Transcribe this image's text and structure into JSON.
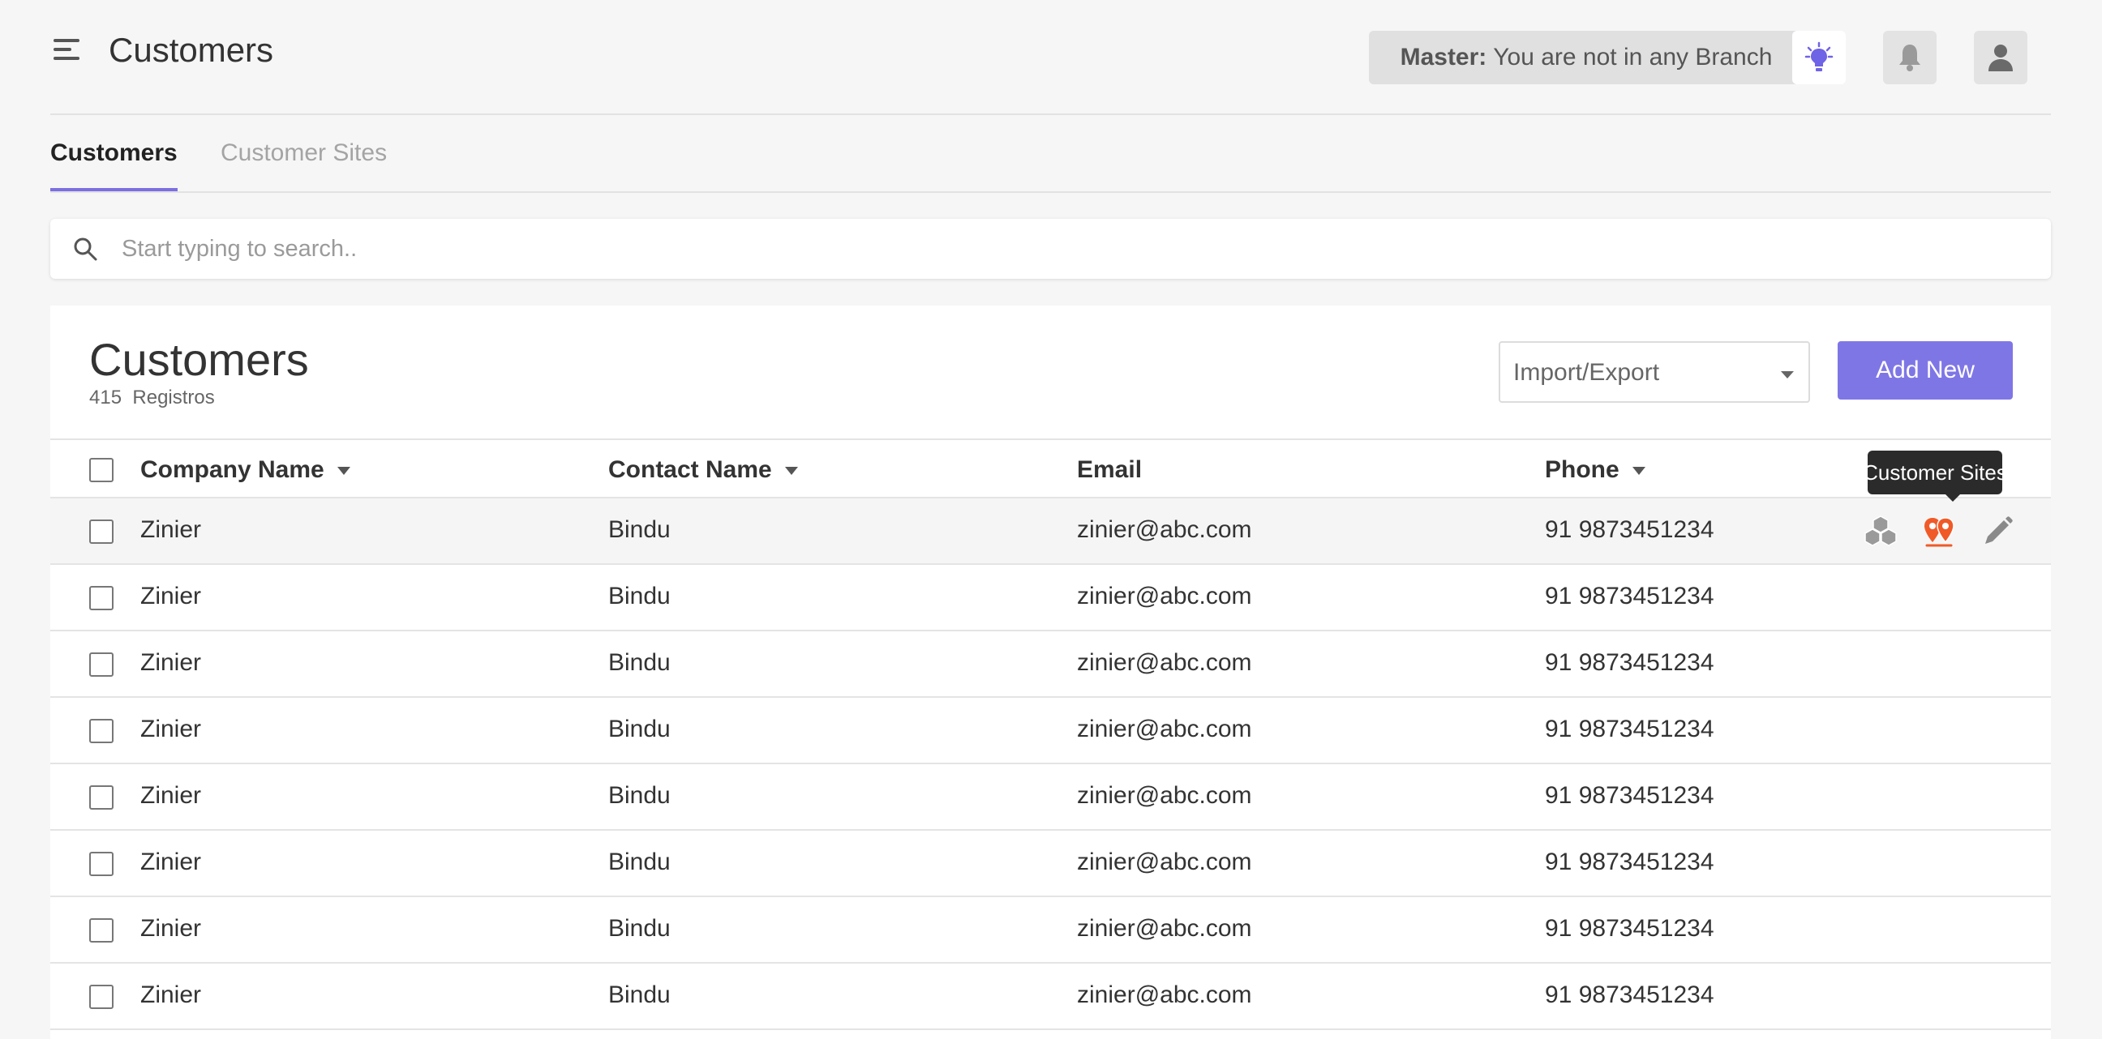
{
  "header": {
    "title": "Customers",
    "branch_label": "Master:",
    "branch_value": "You are not in any Branch",
    "menu_icon": "hamburger-menu-icon",
    "bulb_icon": "lightbulb-icon",
    "bell_icon": "bell-icon",
    "user_icon": "user-icon"
  },
  "tabs": [
    {
      "label": "Customers",
      "active": true
    },
    {
      "label": "Customer Sites",
      "active": false
    }
  ],
  "search": {
    "placeholder": "Start typing to search..",
    "value": ""
  },
  "card": {
    "title": "Customers",
    "count": "415",
    "count_label": "Registros",
    "import_export_label": "Import/Export",
    "add_new_label": "Add New"
  },
  "table": {
    "columns": [
      {
        "label": "Company Name",
        "sortable": true
      },
      {
        "label": "Contact Name",
        "sortable": true
      },
      {
        "label": "Email",
        "sortable": false
      },
      {
        "label": "Phone",
        "sortable": true
      }
    ],
    "rows": [
      {
        "company": "Zinier",
        "contact": "Bindu",
        "email": "zinier@abc.com",
        "phone": "91 9873451234"
      },
      {
        "company": "Zinier",
        "contact": "Bindu",
        "email": "zinier@abc.com",
        "phone": "91 9873451234"
      },
      {
        "company": "Zinier",
        "contact": "Bindu",
        "email": "zinier@abc.com",
        "phone": "91 9873451234"
      },
      {
        "company": "Zinier",
        "contact": "Bindu",
        "email": "zinier@abc.com",
        "phone": "91 9873451234"
      },
      {
        "company": "Zinier",
        "contact": "Bindu",
        "email": "zinier@abc.com",
        "phone": "91 9873451234"
      },
      {
        "company": "Zinier",
        "contact": "Bindu",
        "email": "zinier@abc.com",
        "phone": "91 9873451234"
      },
      {
        "company": "Zinier",
        "contact": "Bindu",
        "email": "zinier@abc.com",
        "phone": "91 9873451234"
      },
      {
        "company": "Zinier",
        "contact": "Bindu",
        "email": "zinier@abc.com",
        "phone": "91 9873451234"
      }
    ],
    "row_action_icons": [
      "cubes-icon",
      "map-pin-icon",
      "pencil-icon"
    ]
  },
  "tooltip": {
    "text": "Customer Sites"
  },
  "colors": {
    "accent": "#7f76e6",
    "bulb": "#6f63e6",
    "map_pin": "#f05a28"
  }
}
